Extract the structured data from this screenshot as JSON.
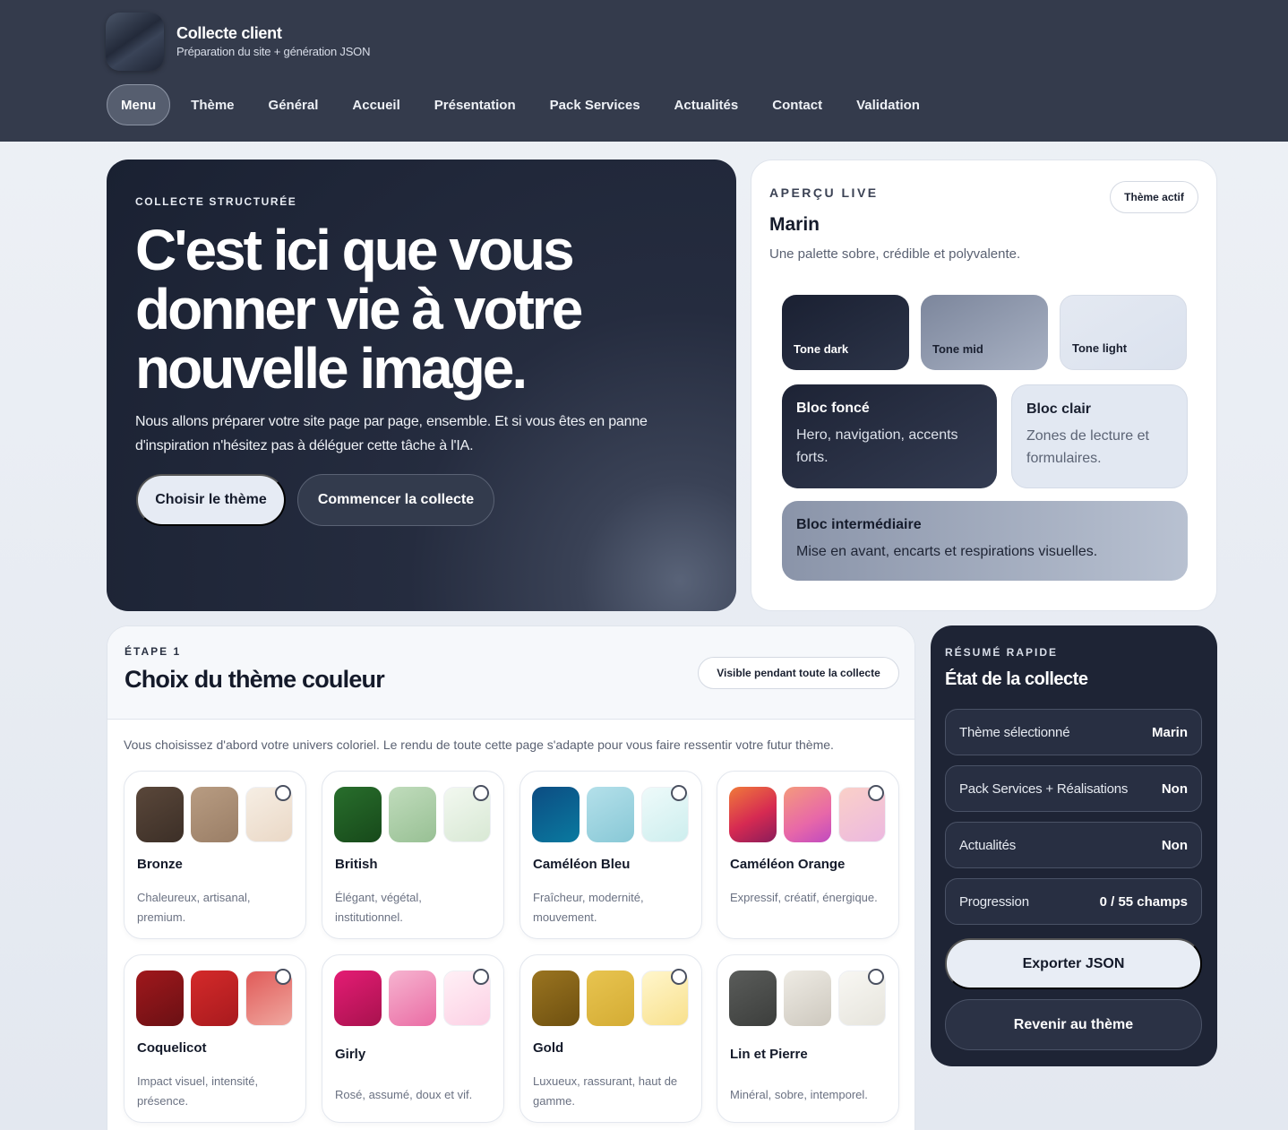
{
  "brand": {
    "title": "Collecte client",
    "subtitle": "Préparation du site + génération JSON"
  },
  "nav": {
    "items": [
      {
        "label": "Menu",
        "active": true
      },
      {
        "label": "Thème"
      },
      {
        "label": "Général"
      },
      {
        "label": "Accueil"
      },
      {
        "label": "Présentation"
      },
      {
        "label": "Pack Services"
      },
      {
        "label": "Actualités"
      },
      {
        "label": "Contact"
      },
      {
        "label": "Validation"
      }
    ]
  },
  "hero": {
    "kicker": "COLLECTE STRUCTURÉE",
    "title": "C'est ici que vous donner vie à votre nouvelle image.",
    "description": "Nous allons préparer votre site page par page, ensemble. Et si vous êtes en panne d'inspiration n'hésitez pas à déléguer cette tâche à l'IA.",
    "primary_button": "Choisir le thème",
    "secondary_button": "Commencer la collecte"
  },
  "preview": {
    "kicker": "APERÇU LIVE",
    "badge": "Thème actif",
    "theme_name": "Marin",
    "theme_description": "Une palette sobre, crédible et polyvalente.",
    "tones": [
      "Tone dark",
      "Tone mid",
      "Tone light"
    ],
    "blocs": {
      "dark": {
        "title": "Bloc foncé",
        "description": "Hero, navigation, accents forts."
      },
      "light": {
        "title": "Bloc clair",
        "description": "Zones de lecture et formulaires."
      },
      "mid": {
        "title": "Bloc intermédiaire",
        "description": "Mise en avant, encarts et respirations visuelles."
      }
    }
  },
  "step": {
    "kicker": "ÉTAPE 1",
    "title": "Choix du thème couleur",
    "badge": "Visible pendant toute la collecte",
    "description": "Vous choisissez d'abord votre univers coloriel. Le rendu de toute cette page s'adapte pour vous faire ressentir votre futur thème.",
    "themes": [
      {
        "name": "Bronze",
        "description": "Chaleureux, artisanal, premium.",
        "colors": [
          "#4a3a30",
          "#a88a70",
          "#f0e4d6"
        ]
      },
      {
        "name": "British",
        "description": "Élégant, végétal, institutionnel.",
        "colors": [
          "#1e5c22",
          "#a8cca6",
          "#e6f0e2"
        ]
      },
      {
        "name": "Caméléon Bleu",
        "description": "Fraîcheur, modernité, mouvement.",
        "colors": [
          "#0a5a8c",
          "#9cd4e0",
          "#e0f4f4"
        ]
      },
      {
        "name": "Caméléon Orange",
        "description": "Expressif, créatif, énergique.",
        "colors": [
          "#d6304a",
          "#ea72a8",
          "#f2bcdc"
        ]
      },
      {
        "name": "Coquelicot",
        "description": "Impact visuel, intensité, présence.",
        "colors": [
          "#8c1a1e",
          "#c42424",
          "#e8706e"
        ]
      },
      {
        "name": "Girly",
        "description": "Rosé, assumé, doux et vif.",
        "colors": [
          "#d41a68",
          "#f098c0",
          "#fde0ec"
        ]
      },
      {
        "name": "Gold",
        "description": "Luxueux, rassurant, haut de gamme.",
        "colors": [
          "#8a6418",
          "#dcb840",
          "#fbeeb0"
        ]
      },
      {
        "name": "Lin et Pierre",
        "description": "Minéral, sobre, intemporel.",
        "colors": [
          "#4e5050",
          "#d8d4cc",
          "#eeede8"
        ]
      }
    ]
  },
  "summary": {
    "kicker": "RÉSUMÉ RAPIDE",
    "title": "État de la collecte",
    "rows": [
      {
        "label": "Thème sélectionné",
        "value": "Marin"
      },
      {
        "label": "Pack Services + Réalisations",
        "value": "Non"
      },
      {
        "label": "Actualités",
        "value": "Non"
      },
      {
        "label": "Progression",
        "value": "0 / 55 champs"
      }
    ],
    "export_button": "Exporter JSON",
    "back_button": "Revenir au thème"
  }
}
